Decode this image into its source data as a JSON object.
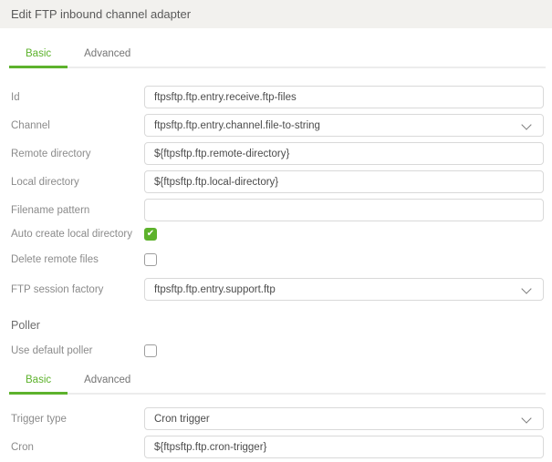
{
  "header": {
    "title": "Edit FTP inbound channel adapter"
  },
  "colors": {
    "accent_green": "#5db22c",
    "header_bg": "#f2f1ee",
    "input_border": "#d9d9d9"
  },
  "tabs_main": {
    "items": [
      {
        "label": "Basic",
        "active": true
      },
      {
        "label": "Advanced",
        "active": false
      }
    ]
  },
  "form": {
    "fields": [
      {
        "label": "Id",
        "type": "text",
        "value": "ftpsftp.ftp.entry.receive.ftp-files"
      },
      {
        "label": "Channel",
        "type": "select",
        "value": "ftpsftp.ftp.entry.channel.file-to-string"
      },
      {
        "label": "Remote directory",
        "type": "text",
        "value": "${ftpsftp.ftp.remote-directory}"
      },
      {
        "label": "Local directory",
        "type": "text",
        "value": "${ftpsftp.ftp.local-directory}"
      },
      {
        "label": "Filename pattern",
        "type": "text",
        "value": ""
      },
      {
        "label": "Auto create local directory",
        "type": "checkbox",
        "checked": true
      },
      {
        "label": "Delete remote files",
        "type": "checkbox",
        "checked": false
      },
      {
        "label": "FTP session factory",
        "type": "select",
        "value": "ftpsftp.ftp.entry.support.ftp"
      }
    ]
  },
  "poller": {
    "heading": "Poller",
    "use_default": {
      "label": "Use default poller",
      "checked": false
    },
    "tabs": {
      "items": [
        {
          "label": "Basic",
          "active": true
        },
        {
          "label": "Advanced",
          "active": false
        }
      ]
    },
    "fields": [
      {
        "label": "Trigger type",
        "type": "select",
        "value": "Cron trigger"
      },
      {
        "label": "Cron",
        "type": "text",
        "value": "${ftpsftp.ftp.cron-trigger}"
      }
    ]
  },
  "icons": {
    "chevron_down": "chevron-down",
    "check": "check"
  }
}
